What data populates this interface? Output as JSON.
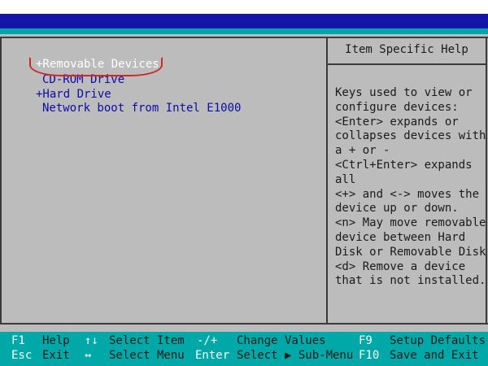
{
  "help": {
    "title": "Item Specific Help",
    "lines": [
      "Keys used to view or",
      "configure devices:",
      "<Enter> expands or",
      "collapses devices with",
      "a + or -",
      "<Ctrl+Enter> expands",
      "all",
      "<+> and <-> moves the",
      "device up or down.",
      "<n> May move removable",
      "device between Hard",
      "Disk or Removable Disk",
      "<d> Remove a device",
      "that is not installed."
    ]
  },
  "boot_order": {
    "items": [
      {
        "label": "+Removable Devices",
        "selected": true
      },
      {
        "label": "CD-ROM Drive",
        "selected": false
      },
      {
        "label": "+Hard Drive",
        "selected": false
      },
      {
        "label": "Network boot from Intel E1000",
        "selected": false
      }
    ]
  },
  "footer": {
    "row1": [
      {
        "key": "F1",
        "desc": "Help"
      },
      {
        "key": "↑↓",
        "desc": "Select Item"
      },
      {
        "key": "-/+",
        "desc": "Change Values"
      },
      {
        "key": "F9",
        "desc": "Setup Defaults"
      }
    ],
    "row2": [
      {
        "key": "Esc",
        "desc": "Exit"
      },
      {
        "key": "↔",
        "desc": "Select Menu"
      },
      {
        "key": "Enter",
        "desc": "Select ▶ Sub-Menu"
      },
      {
        "key": "F10",
        "desc": "Save and Exit"
      }
    ]
  },
  "colors": {
    "title_bar": "#1414a8",
    "footer": "#00a8a8",
    "panel": "#bcbcbc",
    "item_text": "#0c0ca8",
    "annotation": "#cc2a2a"
  }
}
